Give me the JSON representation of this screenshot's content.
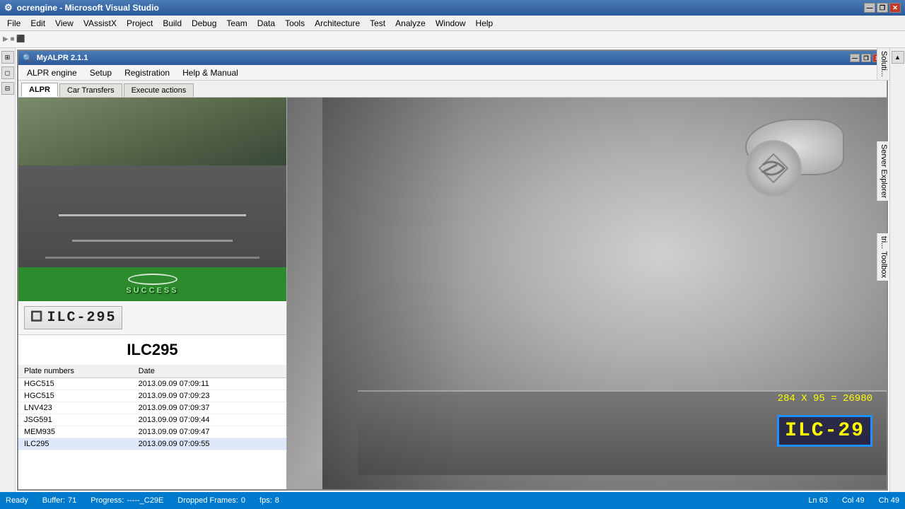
{
  "window": {
    "title": "ocrengine - Microsoft Visual Studio",
    "inner_title": "MyALPR 2.1.1"
  },
  "vs_menu": {
    "items": [
      "File",
      "Edit",
      "View",
      "VAssistX",
      "Project",
      "Build",
      "Debug",
      "Team",
      "Data",
      "Tools",
      "Architecture",
      "Test",
      "Analyze",
      "Window",
      "Help"
    ]
  },
  "app_menu": {
    "items": [
      "ALPR engine",
      "Setup",
      "Registration",
      "Help & Manual"
    ]
  },
  "tabs": {
    "items": [
      "ALPR",
      "Car Transfers",
      "Execute actions"
    ],
    "active": "ALPR"
  },
  "camera": {
    "success_text": "SUCCESS"
  },
  "plate": {
    "image_text": "ILC-295",
    "number": "ILC295"
  },
  "table": {
    "headers": [
      "Plate numbers",
      "Date"
    ],
    "rows": [
      {
        "plate": "HGC515",
        "date": "2013.09.09 07:09:11"
      },
      {
        "plate": "HGC515",
        "date": "2013.09.09 07:09:23"
      },
      {
        "plate": "LNV423",
        "date": "2013.09.09 07:09:37"
      },
      {
        "plate": "JSG591",
        "date": "2013.09.09 07:09:44"
      },
      {
        "plate": "MEM935",
        "date": "2013.09.09 07:09:47"
      },
      {
        "plate": "ILC295",
        "date": "2013.09.09 07:09:55"
      }
    ]
  },
  "overlay": {
    "dims": "284 X 95 = 26980",
    "plate_text": "ILC-29"
  },
  "status_bar": {
    "buffer_label": "Buffer:",
    "buffer_value": "71",
    "progress_label": "Progress:",
    "progress_value": "-----_C29E",
    "dropped_label": "Dropped Frames:",
    "dropped_value": "0",
    "fps_label": "fps:",
    "fps_value": "8",
    "ln": "Ln 63",
    "col": "Col 49",
    "ch": "Ch 49",
    "ready": "Ready"
  },
  "sidebar": {
    "solution_label": "Soluti...",
    "server_label": "Server Explorer",
    "toolbox_label": "tri... Toolbox"
  },
  "title_controls": {
    "minimize": "—",
    "restore": "❐",
    "close": "✕"
  }
}
